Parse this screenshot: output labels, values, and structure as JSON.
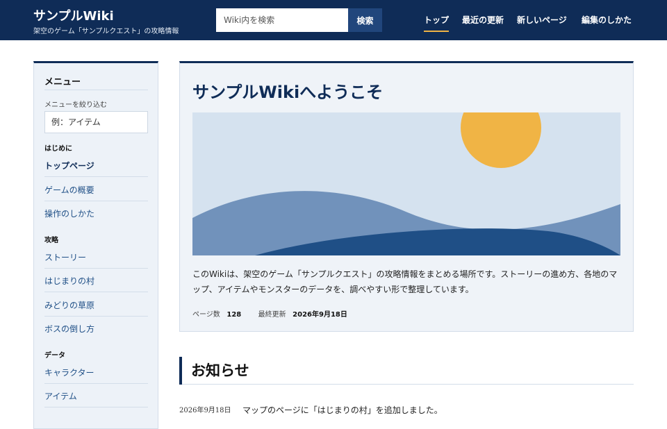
{
  "header": {
    "title": "サンプルWiki",
    "subtitle": "架空のゲーム「サンプルクエスト」の攻略情報",
    "search_placeholder": "Wiki内を検索",
    "search_button": "検索",
    "nav": [
      {
        "label": "トップ",
        "active": true
      },
      {
        "label": "最近の更新",
        "active": false
      },
      {
        "label": "新しいページ",
        "active": false
      },
      {
        "label": "編集のしかた",
        "active": false
      }
    ],
    "accent_color": "#f0b445",
    "bg_color": "#0f2c57"
  },
  "sidebar": {
    "menu_title": "メニュー",
    "filter_label": "メニューを絞り込む",
    "filter_placeholder": "例：アイテム",
    "sections": [
      {
        "label": "はじめに",
        "items": [
          "トップページ",
          "ゲームの概要",
          "操作のしかた"
        ]
      },
      {
        "label": "攻略",
        "items": [
          "ストーリー",
          "はじまりの村",
          "みどりの草原",
          "ボスの倒し方"
        ]
      },
      {
        "label": "データ",
        "items": [
          "キャラクター",
          "アイテム"
        ]
      }
    ],
    "active_item": "トップページ"
  },
  "main": {
    "title": "サンプルWikiへようこそ",
    "intro": "このWikiは、架空のゲーム「サンプルクエスト」の攻略情報をまとめる場所です。ストーリーの進め方、各地のマップ、アイテムやモンスターのデータを、調べやすい形で整理しています。",
    "meta": {
      "pages_label": "ページ数",
      "pages_value": "128",
      "updated_label": "最終更新",
      "updated_value": "2026年9月18日"
    }
  },
  "news": {
    "title": "お知らせ",
    "items": [
      {
        "date": "2026年9月18日",
        "text": "マップのページに「はじまりの村」を追加しました。"
      }
    ]
  }
}
